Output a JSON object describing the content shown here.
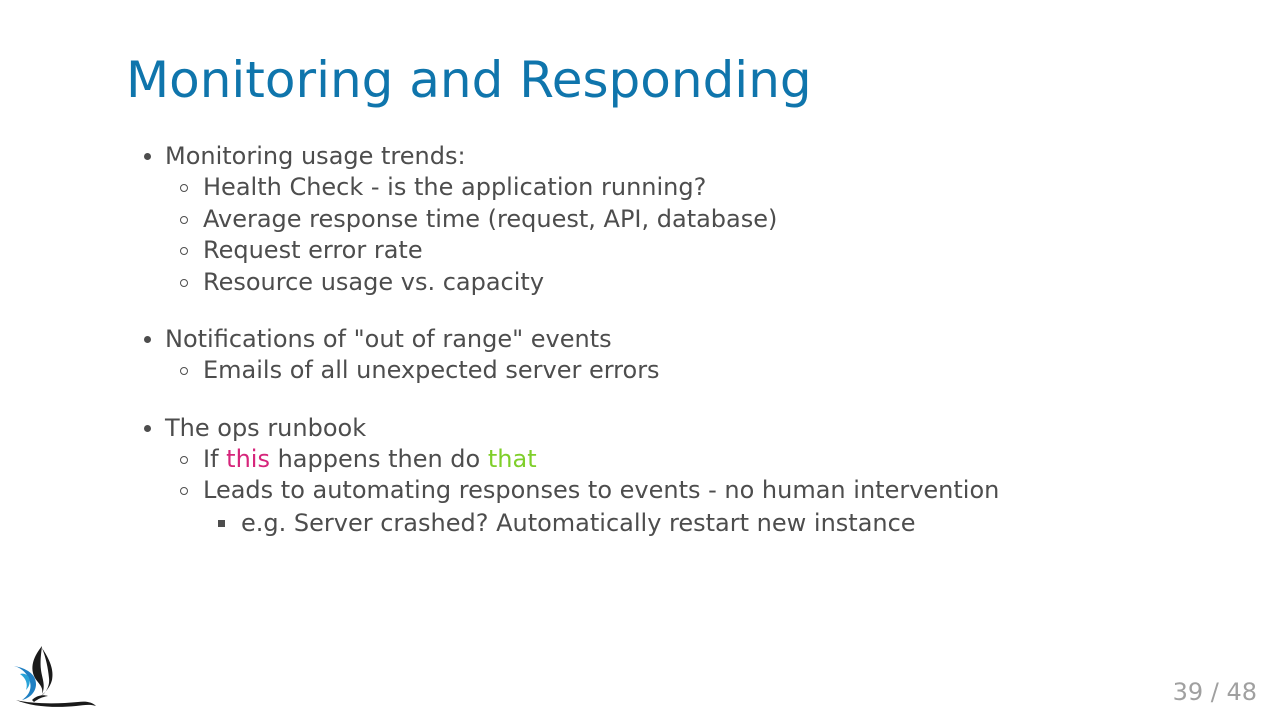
{
  "slide": {
    "title": "Monitoring and Responding",
    "page_number": "39 / 48"
  },
  "content": {
    "section1": {
      "heading": "Monitoring usage trends:",
      "items": [
        "Health Check - is the application running?",
        "Average response time (request, API, database)",
        "Request error rate",
        "Resource usage vs. capacity"
      ]
    },
    "section2": {
      "heading": "Notifications of \"out of range\" events",
      "items": [
        "Emails of all unexpected server errors"
      ]
    },
    "section3": {
      "heading": "The ops runbook",
      "runbook_line": {
        "prefix": "If ",
        "highlight1": "this",
        "middle": " happens then do ",
        "highlight2": "that"
      },
      "item2": "Leads to automating responses to events - no human intervention",
      "subitem": "e.g. Server crashed? Automatically restart new instance"
    }
  },
  "colors": {
    "title": "#0f75ac",
    "highlight_this": "#d6257b",
    "highlight_that": "#7fcf2a",
    "text": "#4d4d4d",
    "page_number": "#a0a0a0"
  },
  "icons": {
    "logo": "bird-logo-icon"
  }
}
